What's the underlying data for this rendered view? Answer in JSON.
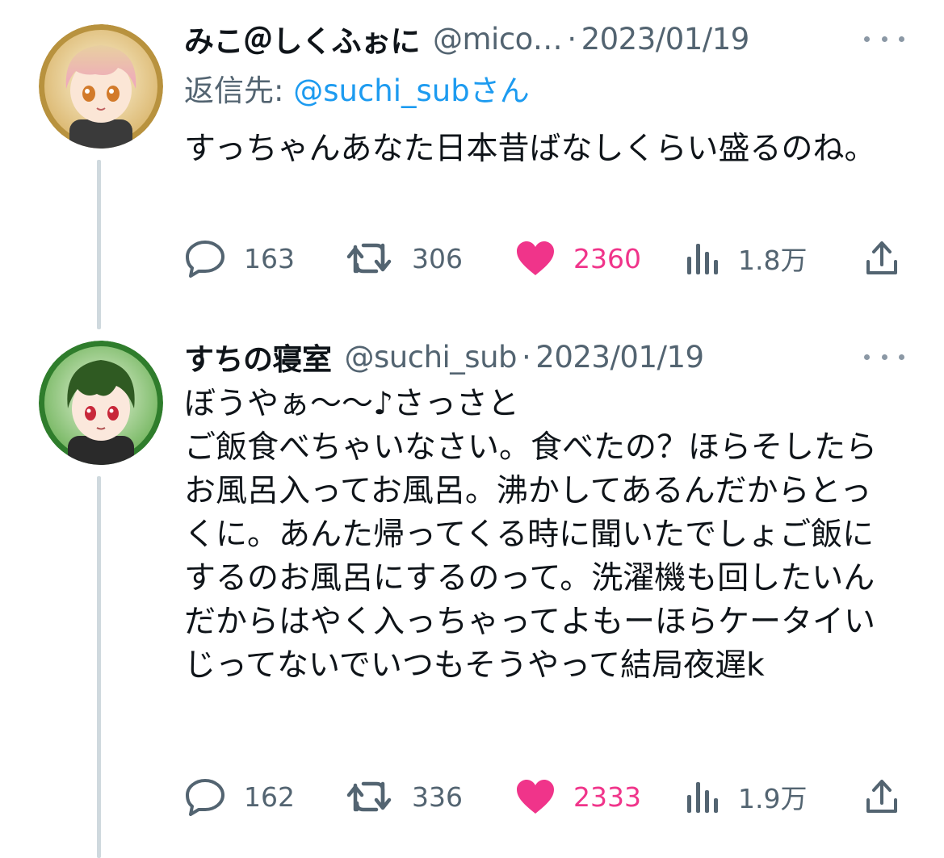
{
  "tweets": [
    {
      "display_name": "みこ＠しくふぉに",
      "handle": "@mico…",
      "separator": "·",
      "date": "2023/01/19",
      "reply_prefix": "返信先: ",
      "reply_mention": "@suchi_sub",
      "reply_suffix": "さん",
      "text": "すっちゃんあなた日本昔ばなしくらい盛るのね。",
      "avatar_icon": "avatar-pink-hair-icon",
      "stats": {
        "replies": "163",
        "retweets": "306",
        "likes": "2360",
        "views": "1.8万"
      }
    },
    {
      "display_name": "すちの寝室",
      "handle": "@suchi_sub",
      "separator": "·",
      "date": "2023/01/19",
      "text": "ぼうやぁ〜〜♪さっさと\nご飯食べちゃいなさい。食べたの？ほらそしたらお風呂入ってお風呂。沸かしてあるんだからとっくに。あんた帰ってくる時に聞いたでしょご飯にするのお風呂にするのって。洗濯機も回したいんだからはやく入っちゃってよもーほらケータイいじってないでいつもそうやって結局夜遅k",
      "avatar_icon": "avatar-green-hair-icon",
      "stats": {
        "replies": "162",
        "retweets": "336",
        "likes": "2333",
        "views": "1.9万"
      }
    }
  ],
  "colors": {
    "text": "#0f1419",
    "secondary": "#536471",
    "mention": "#1d9bf0",
    "like": "#f0348a",
    "thread_line": "#cfd9de"
  },
  "icons": [
    "reply-icon",
    "retweet-icon",
    "heart-icon",
    "views-icon",
    "share-icon",
    "more-icon"
  ]
}
